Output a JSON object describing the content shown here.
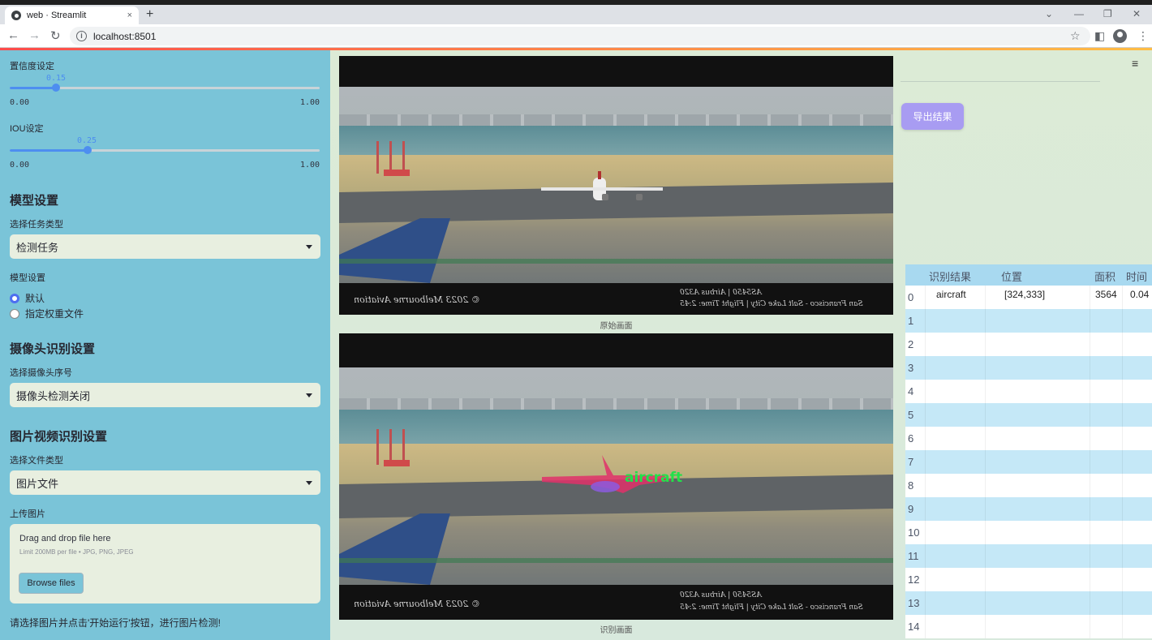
{
  "browser": {
    "tab_title": "web · Streamlit",
    "tab_close": "×",
    "new_tab": "+",
    "url": "localhost:8501",
    "win_minimize": "—",
    "win_restore": "❐",
    "win_close": "✕",
    "dropdown": "⌄"
  },
  "sidebar": {
    "conf_label": "置信度设定",
    "conf_value": "0.15",
    "conf_min": "0.00",
    "conf_max": "1.00",
    "conf_fraction": 0.15,
    "iou_label": "IOU设定",
    "iou_value": "0.25",
    "iou_min": "0.00",
    "iou_max": "1.00",
    "iou_fraction": 0.25,
    "model_heading": "模型设置",
    "task_label": "选择任务类型",
    "task_value": "检测任务",
    "model_label": "模型设置",
    "radio_default": "默认",
    "radio_custom": "指定权重文件",
    "camera_heading": "摄像头识别设置",
    "camera_label": "选择摄像头序号",
    "camera_value": "摄像头检测关闭",
    "media_heading": "图片视频识别设置",
    "filetype_label": "选择文件类型",
    "filetype_value": "图片文件",
    "upload_label": "上传图片",
    "drag_text": "Drag and drop file here",
    "limit_text": "Limit 200MB per file • JPG, PNG, JPEG",
    "browse_label": "Browse files",
    "hint": "请选择图片并点击'开始运行'按钮，进行图片检测!"
  },
  "main": {
    "original_caption": "原始画面",
    "result_caption": "识别画面",
    "export_label": "导出结果",
    "overlay_left": "© 2023 Melbourne Aviation",
    "overlay_right_1": "AS5450  |  Airbus A320",
    "overlay_right_2": "San Francisco - Salt Lake City  |  Flight Time: 2:45",
    "detect_label": "aircraft",
    "menu_icon": "≡"
  },
  "table": {
    "headers": [
      "识别结果",
      "位置",
      "面积",
      "时间"
    ],
    "rows": [
      {
        "idx": "0",
        "result": "aircraft",
        "pos": "[324,333]",
        "area": "3564",
        "time": "0.04"
      },
      {
        "idx": "1",
        "result": "",
        "pos": "",
        "area": "",
        "time": ""
      },
      {
        "idx": "2",
        "result": "",
        "pos": "",
        "area": "",
        "time": ""
      },
      {
        "idx": "3",
        "result": "",
        "pos": "",
        "area": "",
        "time": ""
      },
      {
        "idx": "4",
        "result": "",
        "pos": "",
        "area": "",
        "time": ""
      },
      {
        "idx": "5",
        "result": "",
        "pos": "",
        "area": "",
        "time": ""
      },
      {
        "idx": "6",
        "result": "",
        "pos": "",
        "area": "",
        "time": ""
      },
      {
        "idx": "7",
        "result": "",
        "pos": "",
        "area": "",
        "time": ""
      },
      {
        "idx": "8",
        "result": "",
        "pos": "",
        "area": "",
        "time": ""
      },
      {
        "idx": "9",
        "result": "",
        "pos": "",
        "area": "",
        "time": ""
      },
      {
        "idx": "10",
        "result": "",
        "pos": "",
        "area": "",
        "time": ""
      },
      {
        "idx": "11",
        "result": "",
        "pos": "",
        "area": "",
        "time": ""
      },
      {
        "idx": "12",
        "result": "",
        "pos": "",
        "area": "",
        "time": ""
      },
      {
        "idx": "13",
        "result": "",
        "pos": "",
        "area": "",
        "time": ""
      },
      {
        "idx": "14",
        "result": "",
        "pos": "",
        "area": "",
        "time": ""
      }
    ]
  },
  "colors": {
    "sidebar_bg": "#7ac4d8",
    "slider_accent": "#4d8ef0",
    "export_button": "#a89cf2",
    "detect_mask": "#e0306a",
    "detect_label": "#23e04a"
  }
}
